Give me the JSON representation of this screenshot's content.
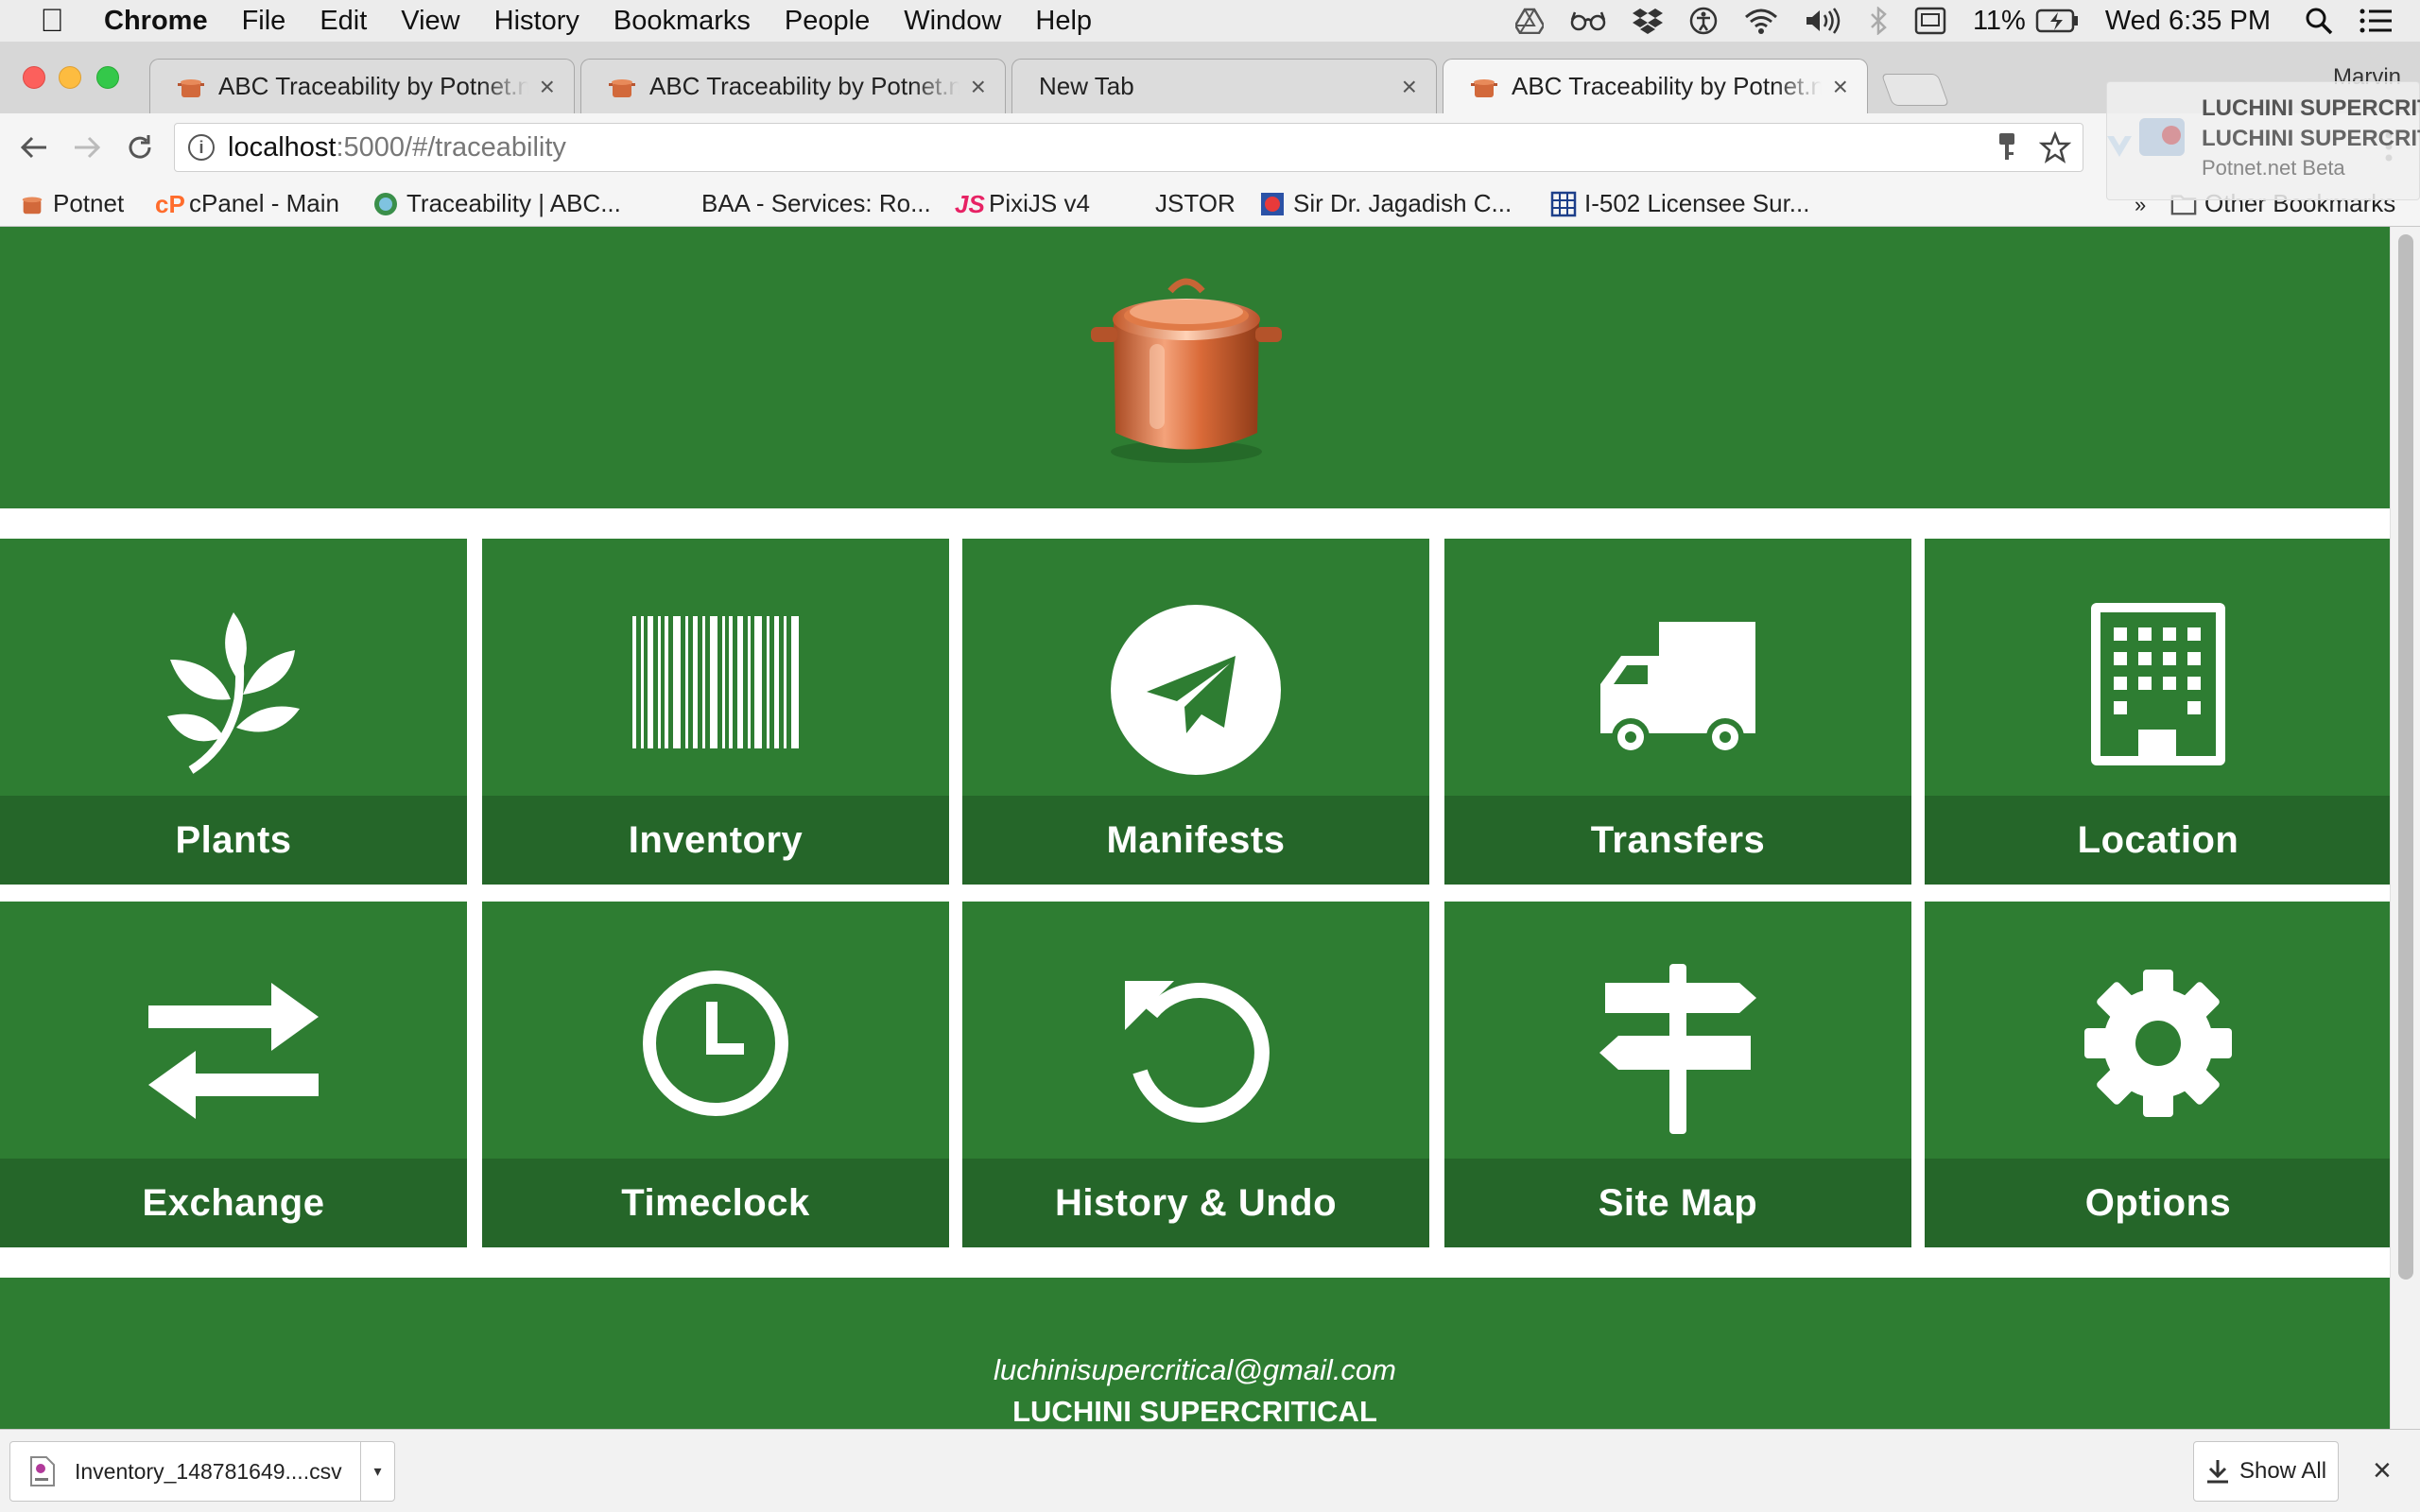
{
  "menubar": {
    "app_name": "Chrome",
    "menus": [
      "File",
      "Edit",
      "View",
      "History",
      "Bookmarks",
      "People",
      "Window",
      "Help"
    ],
    "battery": "11%",
    "clock": "Wed 6:35 PM"
  },
  "tabs": [
    {
      "title": "ABC Traceability by Potnet.net",
      "close": "×"
    },
    {
      "title": "ABC Traceability by Potnet.net",
      "close": "×"
    },
    {
      "title": "New Tab",
      "close": "×"
    },
    {
      "title": "ABC Traceability by Potnet.net",
      "close": "×"
    }
  ],
  "profile_name": "Marvin",
  "address": {
    "host": "localhost",
    "path": ":5000/#/traceability"
  },
  "bookmarks": [
    {
      "label": "Potnet"
    },
    {
      "label": "cPanel - Main"
    },
    {
      "label": "Traceability | ABC..."
    },
    {
      "label": "BAA - Services: Ro..."
    },
    {
      "label": "PixiJS v4"
    },
    {
      "label": "JSTOR"
    },
    {
      "label": "Sir Dr. Jagadish C..."
    },
    {
      "label": "I-502 Licensee Sur..."
    }
  ],
  "bookmarks_overflow": "»",
  "other_bookmarks": "Other Bookmarks",
  "extension_popup": {
    "line1": "LUCHINI SUPERCRITICAL",
    "line2": "LUCHINI SUPERCRITICAL",
    "line3": "Potnet.net Beta"
  },
  "tiles": [
    {
      "label": "Plants",
      "icon": "leaf-icon"
    },
    {
      "label": "Inventory",
      "icon": "barcode-icon"
    },
    {
      "label": "Manifests",
      "icon": "paper-plane-icon"
    },
    {
      "label": "Transfers",
      "icon": "truck-icon"
    },
    {
      "label": "Location",
      "icon": "building-icon"
    },
    {
      "label": "Exchange",
      "icon": "exchange-arrows-icon"
    },
    {
      "label": "Timeclock",
      "icon": "clock-icon"
    },
    {
      "label": "History & Undo",
      "icon": "undo-icon"
    },
    {
      "label": "Site Map",
      "icon": "signpost-icon"
    },
    {
      "label": "Options",
      "icon": "gear-icon"
    }
  ],
  "footer": {
    "email": "luchinisupercritical@gmail.com",
    "company": "LUCHINI SUPERCRITICAL"
  },
  "download": {
    "filename": "Inventory_148781649....csv",
    "show_all": "Show All",
    "close": "×"
  },
  "colors": {
    "brand_green": "#2e7d32",
    "label_bar": "#276b2b",
    "pot_copper": "#d2693b"
  }
}
